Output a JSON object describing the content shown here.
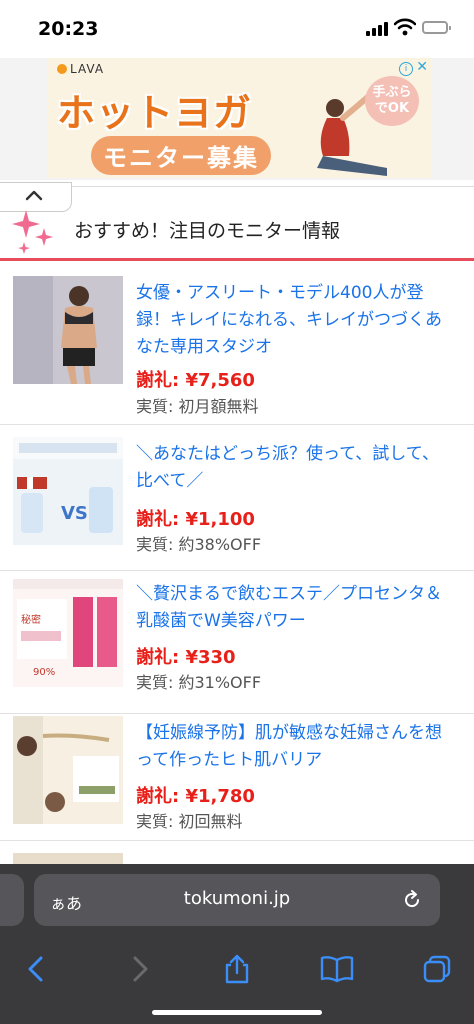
{
  "status_bar": {
    "time": "20:23"
  },
  "ad": {
    "brand": "LAVA",
    "title": "ホットヨガ",
    "subtitle": "モニター募集",
    "badge_line1": "手ぶら",
    "badge_line2": "でOK",
    "info": "i",
    "close": "✕"
  },
  "section": {
    "title": "おすすめ！注目のモニター情報"
  },
  "items": [
    {
      "title": "女優・アスリート・モデル400人が登録！キレイになれる、キレイがつづくあなた専用スタジオ",
      "reward": "謝礼: ¥7,560",
      "real": "実質: 初月額無料"
    },
    {
      "title": "＼あなたはどっち派？使って、試して、比べて／",
      "reward": "謝礼: ¥1,100",
      "real": "実質: 約38%OFF"
    },
    {
      "title": "＼贅沢まるで飲むエステ／プロセンタ＆乳酸菌でW美容パワー",
      "reward": "謝礼: ¥330",
      "real": "実質: 約31%OFF"
    },
    {
      "title": "【妊娠線予防】肌が敏感な妊婦さんを想って作ったヒト肌バリア",
      "reward": "謝礼: ¥1,780",
      "real": "実質: 初回無料"
    }
  ],
  "browser": {
    "aa": "ぁあ",
    "domain": "tokumoni.jp"
  },
  "colors": {
    "accent_red": "#e74c5b",
    "link_blue": "#1a73e8",
    "reward_red": "#e8201a"
  }
}
